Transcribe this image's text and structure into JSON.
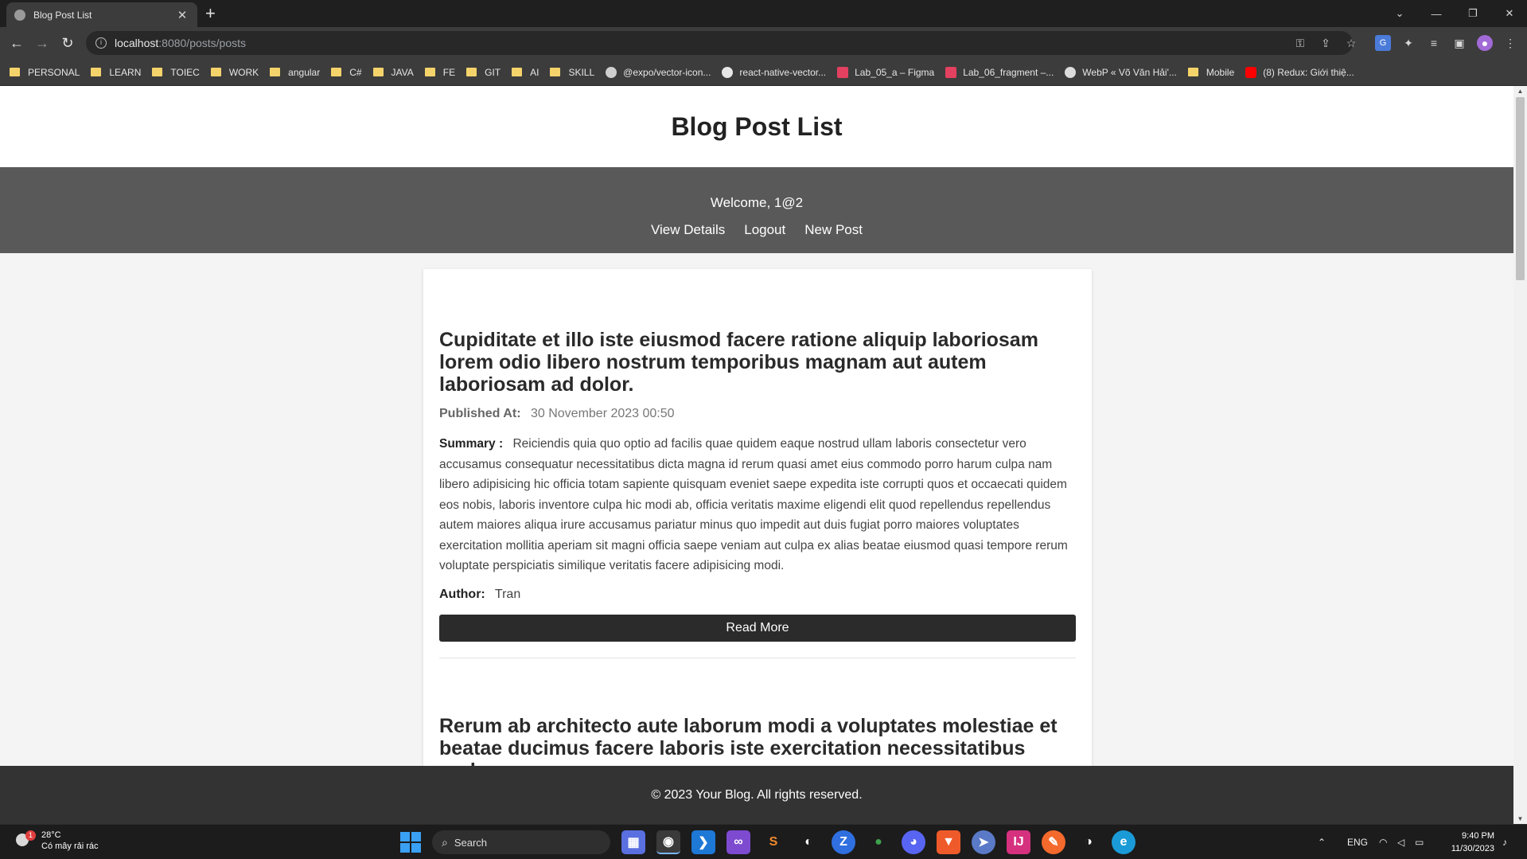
{
  "browser": {
    "tab_title": "Blog Post List",
    "url_host": "localhost",
    "url_path": ":8080/posts/posts",
    "bookmarks": [
      {
        "label": "PERSONAL",
        "icon": "folder-icon"
      },
      {
        "label": "LEARN",
        "icon": "folder-icon"
      },
      {
        "label": "TOIEC",
        "icon": "folder-icon"
      },
      {
        "label": "WORK",
        "icon": "folder-icon"
      },
      {
        "label": "angular",
        "icon": "folder-icon"
      },
      {
        "label": "C#",
        "icon": "folder-icon"
      },
      {
        "label": "JAVA",
        "icon": "folder-icon"
      },
      {
        "label": "FE",
        "icon": "folder-icon"
      },
      {
        "label": "GIT",
        "icon": "folder-icon"
      },
      {
        "label": "AI",
        "icon": "folder-icon"
      },
      {
        "label": "SKILL",
        "icon": "folder-icon"
      },
      {
        "label": "@expo/vector-icon...",
        "icon": "expo-icon"
      },
      {
        "label": "react-native-vector...",
        "icon": "github-icon"
      },
      {
        "label": "Lab_05_a – Figma",
        "icon": "figma-icon"
      },
      {
        "label": "Lab_06_fragment –...",
        "icon": "figma-icon"
      },
      {
        "label": "WebP « Võ Văn Hải'...",
        "icon": "wordpress-icon"
      },
      {
        "label": "Mobile",
        "icon": "folder-icon"
      },
      {
        "label": "(8) Redux: Giới thiệ...",
        "icon": "youtube-icon"
      }
    ]
  },
  "page": {
    "title": "Blog Post List",
    "welcome": "Welcome, 1@2",
    "nav": [
      "View Details",
      "Logout",
      "New Post"
    ],
    "labels": {
      "published": "Published At:",
      "summary": "Summary :",
      "author": "Author:",
      "read_more": "Read More"
    },
    "posts": [
      {
        "title": "Cupiditate et illo iste eiusmod facere ratione aliquip laboriosam lorem odio libero nostrum temporibus magnam aut autem laboriosam ad dolor.",
        "published_at": "30 November 2023 00:50",
        "summary": "Reiciendis quia quo optio ad facilis quae quidem eaque nostrud ullam laboris consectetur vero accusamus consequatur necessitatibus dicta magna id rerum quasi amet eius commodo porro harum culpa nam libero adipisicing hic officia totam sapiente quisquam eveniet saepe expedita iste corrupti quos et occaecati quidem eos nobis, laboris inventore culpa hic modi ab, officia veritatis maxime eligendi elit quod repellendus repellendus autem maiores aliqua irure accusamus pariatur minus quo impedit aut duis fugiat porro maiores voluptates exercitation mollitia aperiam sit magni officia saepe veniam aut culpa ex alias beatae eiusmod quasi tempore rerum voluptate perspiciatis similique veritatis facere adipisicing modi.",
        "author": "Tran"
      },
      {
        "title": "Rerum ab architecto aute laborum modi a voluptates molestiae et beatae ducimus facere laboris iste exercitation necessitatibus unde"
      }
    ],
    "footer": "© 2023 Your Blog. All rights reserved."
  },
  "taskbar": {
    "weather_temp": "28°C",
    "weather_desc": "Có mây rải rác",
    "weather_badge": "1",
    "search_label": "Search",
    "language": "ENG",
    "time": "9:40 PM",
    "date": "11/30/2023"
  },
  "colors": {
    "nav_band": "#595959",
    "button": "#2b2b2b",
    "footer": "#333333",
    "folder": "#f5d36b"
  }
}
